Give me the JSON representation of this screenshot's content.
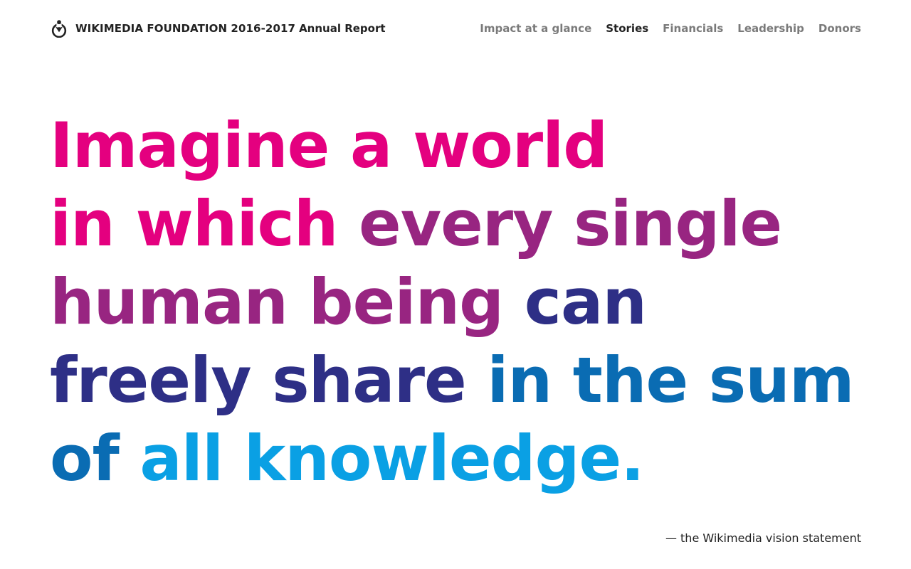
{
  "header": {
    "brand": {
      "name": "WIKIMEDIA FOUNDATION 2016-2017",
      "subtitle": "Annual Report",
      "logo_icon": "wikimedia-logo-icon"
    },
    "nav": [
      {
        "label": "Impact at a glance",
        "active": false
      },
      {
        "label": "Stories",
        "active": true
      },
      {
        "label": "Financials",
        "active": false
      },
      {
        "label": "Leadership",
        "active": false
      },
      {
        "label": "Donors",
        "active": false
      }
    ]
  },
  "vision": {
    "segments": [
      {
        "text": "Imagine a world",
        "color": "#e4007f"
      },
      {
        "text": "in which",
        "color": "#e4007f"
      },
      {
        "text": "every single",
        "color": "#982581"
      },
      {
        "text": "human being",
        "color": "#982581"
      },
      {
        "text": "can",
        "color": "#2e2f86"
      },
      {
        "text": "freely share",
        "color": "#2e2f86"
      },
      {
        "text": "in the sum",
        "color": "#0a6cb3"
      },
      {
        "text": "of",
        "color": "#0a6cb3"
      },
      {
        "text": "all knowledge.",
        "color": "#0aa0e4"
      }
    ],
    "attribution": "— the Wikimedia vision statement"
  },
  "colors": {
    "text_dark": "#222222",
    "nav_inactive": "#7a7a7a",
    "background": "#ffffff"
  }
}
